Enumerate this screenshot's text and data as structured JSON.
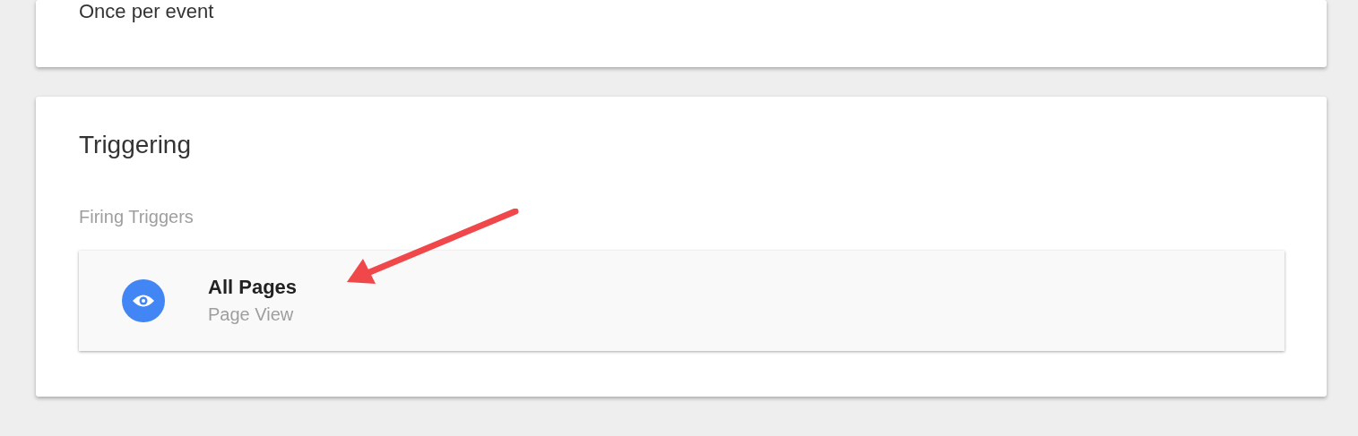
{
  "top_card": {
    "text": "Once per event"
  },
  "triggering": {
    "title": "Triggering",
    "section_label": "Firing Triggers",
    "triggers": [
      {
        "kind": "page_view",
        "name": "All Pages",
        "type": "Page View"
      }
    ]
  },
  "annotation": {
    "kind": "arrow"
  }
}
